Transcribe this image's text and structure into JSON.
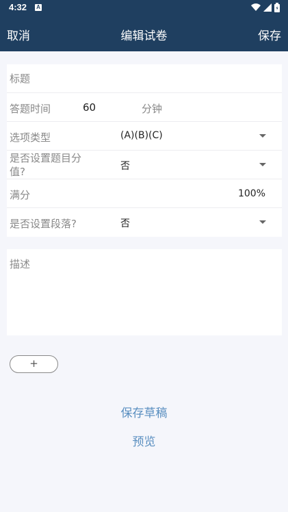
{
  "status_bar": {
    "time": "4:32",
    "notif_icon": "A"
  },
  "app_bar": {
    "cancel_label": "取消",
    "title": "编辑试卷",
    "save_label": "保存"
  },
  "form": {
    "title_placeholder": "标题",
    "duration_label": "答题时间",
    "duration_value": "60",
    "duration_unit": "分钟",
    "option_type_label": "选项类型",
    "option_type_value": "(A)(B)(C)",
    "set_score_label": "是否设置题目分值?",
    "set_score_value": "否",
    "full_score_label": "满分",
    "full_score_value": "100%",
    "set_section_label": "是否设置段落?",
    "set_section_value": "否"
  },
  "description": {
    "placeholder": "描述"
  },
  "add_button_label": "+",
  "actions": {
    "save_draft": "保存草稿",
    "preview": "预览"
  },
  "colors": {
    "header_bg": "#1f3f60",
    "link": "#5a8fc0",
    "page_bg": "#f5f6fb"
  },
  "icons": [
    "wifi-icon",
    "signal-icon",
    "battery-icon",
    "dropdown-caret-icon"
  ]
}
